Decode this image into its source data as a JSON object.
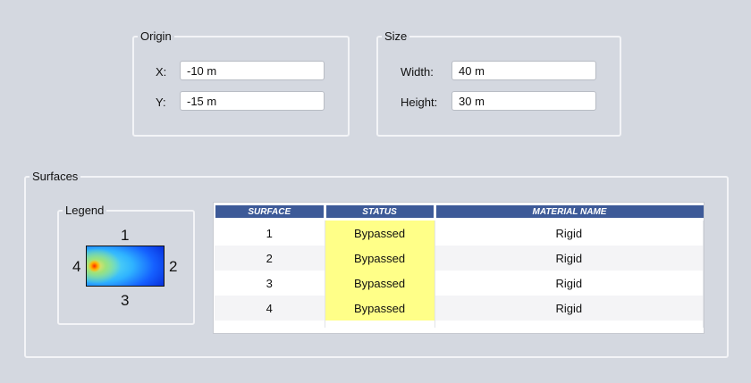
{
  "origin": {
    "title": "Origin",
    "x_label": "X:",
    "x_value": "-10 m",
    "y_label": "Y:",
    "y_value": "-15 m"
  },
  "size": {
    "title": "Size",
    "width_label": "Width:",
    "width_value": "40 m",
    "height_label": "Height:",
    "height_value": "30 m"
  },
  "surfaces": {
    "title": "Surfaces",
    "legend": {
      "title": "Legend",
      "top": "1",
      "right": "2",
      "bottom": "3",
      "left": "4"
    },
    "table": {
      "headers": [
        "SURFACE",
        "STATUS",
        "MATERIAL NAME"
      ],
      "rows": [
        {
          "surface": "1",
          "status": "Bypassed",
          "material": "Rigid"
        },
        {
          "surface": "2",
          "status": "Bypassed",
          "material": "Rigid"
        },
        {
          "surface": "3",
          "status": "Bypassed",
          "material": "Rigid"
        },
        {
          "surface": "4",
          "status": "Bypassed",
          "material": "Rigid"
        }
      ],
      "status_color": "#ffff88",
      "header_color": "#3d5a98"
    }
  }
}
